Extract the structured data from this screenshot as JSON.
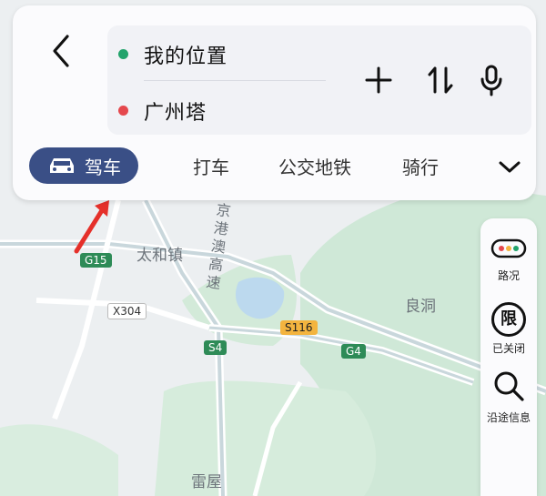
{
  "route": {
    "start": "我的位置",
    "end": "广州塔"
  },
  "tabs": [
    {
      "label": "驾车",
      "active": true
    },
    {
      "label": "打车"
    },
    {
      "label": "公交地铁"
    },
    {
      "label": "骑行"
    }
  ],
  "side_panel": {
    "traffic_label": "路况",
    "limit_label": "已关闭",
    "limit_glyph": "限",
    "search_label": "沿途信息"
  },
  "map": {
    "place_1": "太和镇",
    "place_2": "良洞",
    "place_3": "雷屋",
    "highway": "京港澳高速",
    "badges": {
      "g15": "G15",
      "g4": "G4",
      "s4": "S4",
      "s116": "S116",
      "x304": "X304"
    }
  },
  "colors": {
    "accent": "#3a4f86",
    "start_dot": "#22a36b",
    "end_dot": "#e5484d",
    "arrow": "#e5302a"
  },
  "icons": [
    "back-icon",
    "add-icon",
    "swap-icon",
    "microphone-icon",
    "chevron-down-icon",
    "traffic-light-icon",
    "limit-icon",
    "search-icon"
  ]
}
